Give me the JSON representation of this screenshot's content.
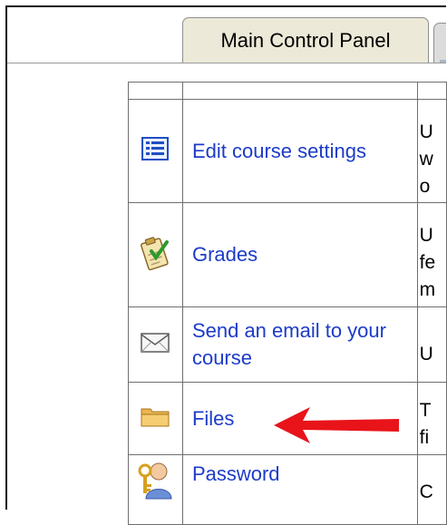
{
  "tabs": [
    {
      "label": "Main Control Panel",
      "active": true
    },
    {
      "label": "",
      "active": false
    }
  ],
  "rows": [
    {
      "icon": "settings-list-icon",
      "label": "Edit course settings",
      "desc_lines": [
        "U",
        "w",
        "o"
      ]
    },
    {
      "icon": "grades-clipboard-icon",
      "label": "Grades",
      "desc_lines": [
        "U",
        "fe",
        "m"
      ]
    },
    {
      "icon": "email-envelope-icon",
      "label": "Send an email to your course",
      "desc_lines": [
        "U"
      ]
    },
    {
      "icon": "folder-icon",
      "label": "Files",
      "desc_lines": [
        "T",
        "fi"
      ]
    },
    {
      "icon": "password-user-key-icon",
      "label": "Password",
      "desc_lines": [
        "C"
      ]
    }
  ],
  "colors": {
    "link": "#1c3bc8",
    "arrow": "#e8141a",
    "tab": "#ece9d8"
  }
}
